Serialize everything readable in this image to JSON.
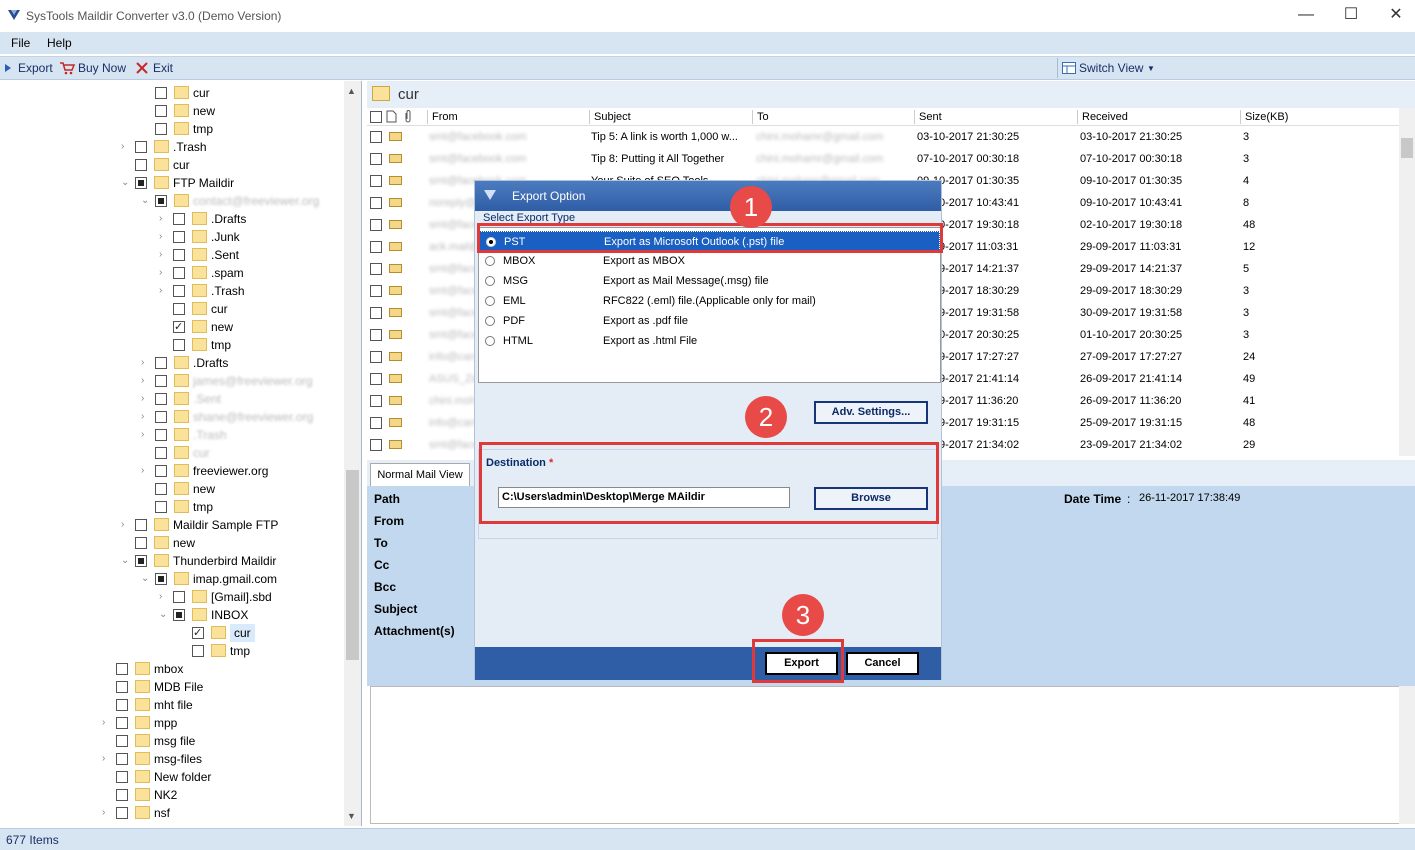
{
  "window": {
    "title": "SysTools Maildir Converter v3.0 (Demo Version)",
    "min": "—",
    "max": "☐",
    "close": "✕"
  },
  "menu": {
    "file": "File",
    "help": "Help"
  },
  "toolbar": {
    "export": "Export",
    "buy_now": "Buy Now",
    "exit": "Exit",
    "switch_view": "Switch View"
  },
  "tree": {
    "items": [
      {
        "label": "cur",
        "indent": 3,
        "cb": "",
        "exp": ""
      },
      {
        "label": "new",
        "indent": 3,
        "cb": "",
        "exp": ""
      },
      {
        "label": "tmp",
        "indent": 3,
        "cb": "",
        "exp": ""
      },
      {
        "label": ".Trash",
        "indent": 2,
        "cb": "",
        "exp": ">"
      },
      {
        "label": "cur",
        "indent": 2,
        "cb": "",
        "exp": ""
      },
      {
        "label": "FTP Maildir",
        "indent": 2,
        "cb": "partial",
        "exp": "v"
      },
      {
        "label": "contact@freeviewer.org",
        "indent": 3,
        "cb": "partial",
        "exp": "v",
        "blur": true
      },
      {
        "label": ".Drafts",
        "indent": 4,
        "cb": "",
        "exp": ">"
      },
      {
        "label": ".Junk",
        "indent": 4,
        "cb": "",
        "exp": ">"
      },
      {
        "label": ".Sent",
        "indent": 4,
        "cb": "",
        "exp": ">"
      },
      {
        "label": ".spam",
        "indent": 4,
        "cb": "",
        "exp": ">"
      },
      {
        "label": ".Trash",
        "indent": 4,
        "cb": "",
        "exp": ">"
      },
      {
        "label": "cur",
        "indent": 4,
        "cb": "",
        "exp": ""
      },
      {
        "label": "new",
        "indent": 4,
        "cb": "checked",
        "exp": ""
      },
      {
        "label": "tmp",
        "indent": 4,
        "cb": "",
        "exp": ""
      },
      {
        "label": ".Drafts",
        "indent": 3,
        "cb": "",
        "exp": ">"
      },
      {
        "label": "james@freeviewer.org",
        "indent": 3,
        "cb": "",
        "exp": ">",
        "blur": true
      },
      {
        "label": ".Sent",
        "indent": 3,
        "cb": "",
        "exp": ">",
        "blur": true
      },
      {
        "label": "shane@freeviewer.org",
        "indent": 3,
        "cb": "",
        "exp": ">",
        "blur": true
      },
      {
        "label": ".Trash",
        "indent": 3,
        "cb": "",
        "exp": ">",
        "blur": true
      },
      {
        "label": "cur",
        "indent": 3,
        "cb": "",
        "exp": "",
        "blur": true
      },
      {
        "label": "freeviewer.org",
        "indent": 3,
        "cb": "",
        "exp": ">"
      },
      {
        "label": "new",
        "indent": 3,
        "cb": "",
        "exp": ""
      },
      {
        "label": "tmp",
        "indent": 3,
        "cb": "",
        "exp": ""
      },
      {
        "label": "Maildir Sample FTP",
        "indent": 2,
        "cb": "",
        "exp": ">"
      },
      {
        "label": "new",
        "indent": 2,
        "cb": "",
        "exp": ""
      },
      {
        "label": "Thunderbird Maildir",
        "indent": 2,
        "cb": "partial",
        "exp": "v"
      },
      {
        "label": "imap.gmail.com",
        "indent": 3,
        "cb": "partial",
        "exp": "v"
      },
      {
        "label": "[Gmail].sbd",
        "indent": 4,
        "cb": "",
        "exp": ">"
      },
      {
        "label": "INBOX",
        "indent": 4,
        "cb": "partial",
        "exp": "v"
      },
      {
        "label": "cur",
        "indent": 5,
        "cb": "checked",
        "exp": "",
        "sel": true
      },
      {
        "label": "tmp",
        "indent": 5,
        "cb": "",
        "exp": ""
      },
      {
        "label": "mbox",
        "indent": 0,
        "cb": "",
        "exp": ""
      },
      {
        "label": "MDB File",
        "indent": 0,
        "cb": "",
        "exp": ""
      },
      {
        "label": "mht file",
        "indent": 0,
        "cb": "",
        "exp": ""
      },
      {
        "label": "mpp",
        "indent": 0,
        "cb": "",
        "exp": ">"
      },
      {
        "label": "msg file",
        "indent": 0,
        "cb": "",
        "exp": ""
      },
      {
        "label": "msg-files",
        "indent": 0,
        "cb": "",
        "exp": ">"
      },
      {
        "label": "New folder",
        "indent": 0,
        "cb": "",
        "exp": ""
      },
      {
        "label": "NK2",
        "indent": 0,
        "cb": "",
        "exp": ""
      },
      {
        "label": "nsf",
        "indent": 0,
        "cb": "",
        "exp": ">"
      }
    ]
  },
  "folder": {
    "name": "cur"
  },
  "columns": {
    "from": "From",
    "subject": "Subject",
    "to": "To",
    "sent": "Sent",
    "received": "Received",
    "size": "Size(KB)"
  },
  "mails": [
    {
      "from": "smt@facebook.com",
      "subject": "Tip 5: A link is worth 1,000 w...",
      "to": "chini.mohamr@gmail.com",
      "sent": "03-10-2017 21:30:25",
      "received": "03-10-2017 21:30:25",
      "size": "3"
    },
    {
      "from": "smt@facebook.com",
      "subject": "Tip 8: Putting it All Together",
      "to": "chini.mohamr@gmail.com",
      "sent": "07-10-2017 00:30:18",
      "received": "07-10-2017 00:30:18",
      "size": "3"
    },
    {
      "from": "smt@facebook.com",
      "subject": "Your Suite of SEO Tools",
      "to": "chini.mohapr@gmail.com",
      "sent": "09-10-2017 01:30:35",
      "received": "09-10-2017 01:30:35",
      "size": "4"
    },
    {
      "from": "noreply@quora.com",
      "subject": "",
      "to": "",
      "sent": "09-10-2017 10:43:41",
      "received": "09-10-2017 10:43:41",
      "size": "8"
    },
    {
      "from": "smt@facebook.com",
      "subject": "",
      "to": "",
      "sent": "02-10-2017 19:30:18",
      "received": "02-10-2017 19:30:18",
      "size": "48"
    },
    {
      "from": "ack.mail@sumo.com",
      "subject": "",
      "to": "",
      "sent": "29-09-2017 11:03:31",
      "received": "29-09-2017 11:03:31",
      "size": "12"
    },
    {
      "from": "smt@facebook.com",
      "subject": "",
      "to": "",
      "sent": "29-09-2017 14:21:37",
      "received": "29-09-2017 14:21:37",
      "size": "5"
    },
    {
      "from": "smt@facebook.com",
      "subject": "",
      "to": "",
      "sent": "29-09-2017 18:30:29",
      "received": "29-09-2017 18:30:29",
      "size": "3"
    },
    {
      "from": "smt@facebook.com",
      "subject": "",
      "to": "",
      "sent": "30-09-2017 19:31:58",
      "received": "30-09-2017 19:31:58",
      "size": "3"
    },
    {
      "from": "smt@facebook.com",
      "subject": "",
      "to": "",
      "sent": "01-10-2017 20:30:25",
      "received": "01-10-2017 20:30:25",
      "size": "3"
    },
    {
      "from": "info@canva.com",
      "subject": "",
      "to": "",
      "sent": "27-09-2017 17:27:27",
      "received": "27-09-2017 17:27:27",
      "size": "24"
    },
    {
      "from": "ASUS_ZenFone",
      "subject": "",
      "to": "",
      "sent": "26-09-2017 21:41:14",
      "received": "26-09-2017 21:41:14",
      "size": "49"
    },
    {
      "from": "chini.moh@ld",
      "subject": "",
      "to": "",
      "sent": "26-09-2017 11:36:20",
      "received": "26-09-2017 11:36:20",
      "size": "41"
    },
    {
      "from": "info@canva.com",
      "subject": "",
      "to": "",
      "sent": "25-09-2017 19:31:15",
      "received": "25-09-2017 19:31:15",
      "size": "48"
    },
    {
      "from": "smt@facebook.com",
      "subject": "",
      "to": "",
      "sent": "23-09-2017 21:34:02",
      "received": "23-09-2017 21:34:02",
      "size": "29"
    }
  ],
  "preview": {
    "tab": "Normal Mail View",
    "path": "Path",
    "from": "From",
    "to": "To",
    "cc": "Cc",
    "bcc": "Bcc",
    "subject": "Subject",
    "attachments": "Attachment(s)",
    "datetime_label": "Date Time",
    "datetime_sep": ":",
    "datetime_value": "26-11-2017 17:38:49"
  },
  "status": {
    "items": "677 Items"
  },
  "dialog": {
    "title": "Export Option",
    "select_label": "Select Export Type",
    "types": [
      {
        "name": "PST",
        "desc": "Export as Microsoft Outlook (.pst) file",
        "selected": true
      },
      {
        "name": "MBOX",
        "desc": "Export as MBOX"
      },
      {
        "name": "MSG",
        "desc": "Export as Mail Message(.msg) file"
      },
      {
        "name": "EML",
        "desc": "RFC822 (.eml) file.(Applicable only for mail)"
      },
      {
        "name": "PDF",
        "desc": "Export as .pdf file"
      },
      {
        "name": "HTML",
        "desc": "Export as .html File"
      }
    ],
    "adv_settings": "Adv. Settings...",
    "destination_label": "Destination",
    "required": "*",
    "destination_path": "C:\\Users\\admin\\Desktop\\Merge MAildir",
    "browse": "Browse",
    "export": "Export",
    "cancel": "Cancel"
  },
  "annotations": {
    "step1": "1",
    "step2": "2",
    "step3": "3"
  },
  "colors": {
    "accent": "#2f5ea7",
    "highlight": "#e0393a",
    "callout": "#e84a47",
    "panel": "#d7e4f2"
  }
}
